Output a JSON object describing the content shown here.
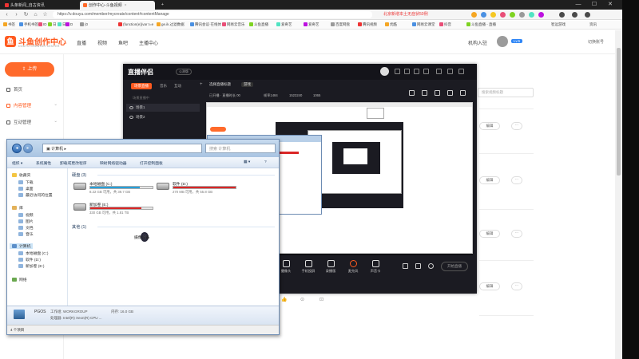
{
  "browser": {
    "tabs": [
      {
        "label": "头条新闻_自古资讯",
        "active": false,
        "color": "#e33"
      },
      {
        "label": "创作中心-斗鱼视频",
        "active": true,
        "color": "#ff6a2b"
      }
    ],
    "new_tab": "+",
    "url": "https://v.douyu.com/member/mycreate/content#contentManage",
    "bookmarks": [
      "书签",
      "手机书签",
      "ID",
      "日",
      "日",
      "D",
      "(0",
      "(function(e){var t=e",
      "ge.ik.过滤数据",
      "腾讯会议·在线体",
      "网易云音乐",
      "斗鱼直播",
      "爱奇艺",
      "爱奇艺",
      "百度网盘",
      "腾讯视频",
      "优酷",
      "网易云课堂",
      "抖音",
      "斗鱼直播 - 直播"
    ],
    "right_bookmarks": [
      "北京新增本土无症状50例",
      "智远游戏",
      "资讯"
    ]
  },
  "site": {
    "logo_text": "斗鱼创作中心",
    "logo_sub": "DOUYU CREATOR CENTER",
    "nav": [
      "直播",
      "视频",
      "鱼吧",
      "主播中心"
    ],
    "user_link": "机构入驻",
    "user_badge": "Lv.5",
    "user_right": "切换账号"
  },
  "sidebar": {
    "upload": "上传",
    "items": [
      {
        "label": "首页",
        "active": false
      },
      {
        "label": "内容管理",
        "active": true
      },
      {
        "label": "互动管理",
        "active": false
      }
    ]
  },
  "content": {
    "search_placeholder": "搜索视频标题",
    "edit_label": "编辑",
    "more_label": "···",
    "bottom_icons": [
      "👍",
      "⊙",
      "⊡"
    ]
  },
  "live_app": {
    "title": "直播伴侣",
    "beta": "公测版",
    "scene_tabs": [
      "场景直播",
      "音乐",
      "互动"
    ],
    "add_scene": "+",
    "scenes": [
      {
        "label": "场景1",
        "selected": true
      },
      {
        "label": "场景2",
        "selected": false
      }
    ],
    "top_items": [
      "选择直播标题",
      "游戏"
    ],
    "stats": [
      "已开播 · 直播时长 00",
      "帧率1484",
      "1523240",
      "1065"
    ],
    "scene_hint": "场景直播中",
    "bottom_buttons": [
      {
        "label": "摄像头"
      },
      {
        "label": "手机投屏"
      },
      {
        "label": "录播版"
      },
      {
        "label": "麦克风"
      },
      {
        "label": "声音卡"
      }
    ],
    "start_button": "开始直播"
  },
  "explorer": {
    "address": "计算机 ▸",
    "search_placeholder": "搜索 计算机",
    "toolbar": [
      "组织 ▾",
      "系统属性",
      "卸载或更改程序",
      "映射网络驱动器",
      "打开控制面板"
    ],
    "nav": [
      {
        "label": "收藏夹",
        "kind": "fav",
        "selected": false
      },
      {
        "label": "下载",
        "kind": "sub",
        "selected": false
      },
      {
        "label": "桌面",
        "kind": "sub",
        "selected": false
      },
      {
        "label": "最近访问的位置",
        "kind": "sub",
        "selected": false
      },
      {
        "label": "库",
        "kind": "lib",
        "selected": false
      },
      {
        "label": "视频",
        "kind": "sub",
        "selected": false
      },
      {
        "label": "图片",
        "kind": "sub",
        "selected": false
      },
      {
        "label": "文档",
        "kind": "sub",
        "selected": false
      },
      {
        "label": "音乐",
        "kind": "sub",
        "selected": false
      },
      {
        "label": "计算机",
        "kind": "pc",
        "selected": true
      },
      {
        "label": "本地磁盘 (C:)",
        "kind": "sub",
        "selected": false
      },
      {
        "label": "软件 (D:)",
        "kind": "sub",
        "selected": false
      },
      {
        "label": "新加卷 (E:)",
        "kind": "sub",
        "selected": false
      },
      {
        "label": "网络",
        "kind": "net",
        "selected": false
      }
    ],
    "group_disks": "硬盘 (3)",
    "group_other": "其他 (1)",
    "drives": [
      {
        "name": "本地磁盘 (C:)",
        "info": "8.22 GB 可用，共 39.7 GB",
        "used_fraction": 0.79,
        "color": "#26a0da"
      },
      {
        "name": "软件 (D:)",
        "info": "270 MB 可用，共 55.8 GB",
        "used_fraction": 0.995,
        "color": "#da2626"
      },
      {
        "name": "新加卷 (E:)",
        "info": "330 GB 可用，共 1.81 TB",
        "used_fraction": 0.82,
        "color": "#da2626"
      }
    ],
    "other_device": "摄像设备",
    "details": {
      "pc_name": "PGOS",
      "workgroup": "工作组: WORKGROUP",
      "memory": "内存: 16.0 GB",
      "cpu": "处理器: Intel(R) Xeon(R) CPU ..."
    },
    "status": "4 个项目"
  }
}
